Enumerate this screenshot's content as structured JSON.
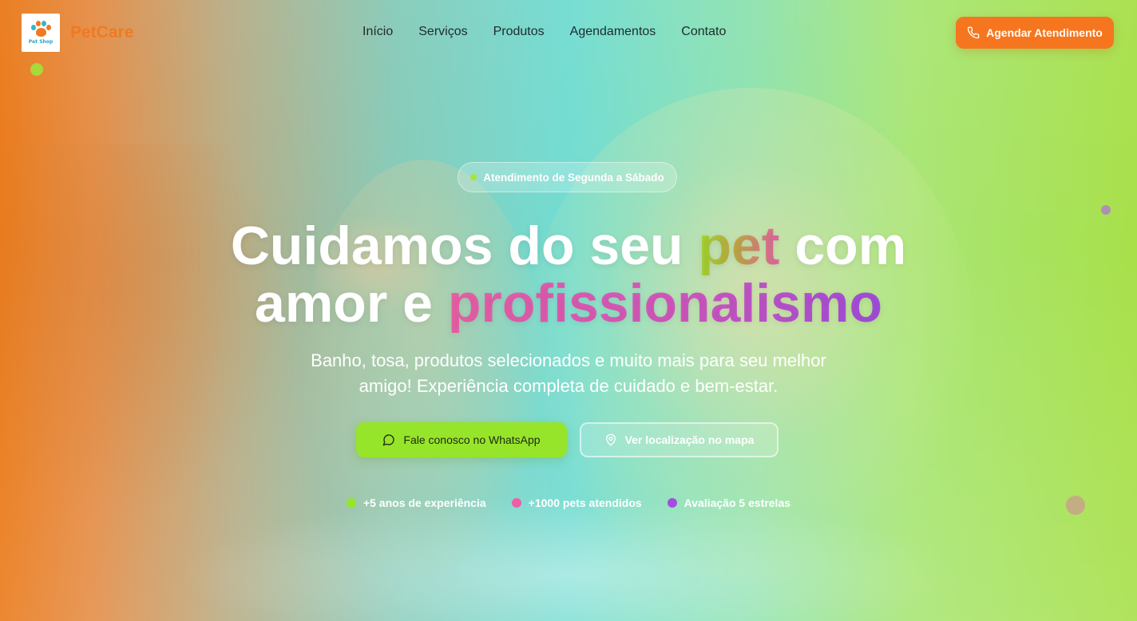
{
  "brand": {
    "name": "PetCare",
    "logo_caption": "Pet Shop",
    "color": "#f07a20"
  },
  "nav": {
    "items": [
      "Início",
      "Serviços",
      "Produtos",
      "Agendamentos",
      "Contato"
    ]
  },
  "header_cta": {
    "label": "Agendar Atendimento",
    "icon": "phone-icon",
    "color": "#f5761e"
  },
  "hero": {
    "badge": "Atendimento de Segunda a Sábado",
    "headline": {
      "part1": "Cuidamos do seu ",
      "highlight1": "pet",
      "part2": " com",
      "part3": "amor e ",
      "highlight2": "profissionalismo"
    },
    "subtitle_line1": "Banho, tosa, produtos selecionados e muito mais para seu melhor",
    "subtitle_line2": "amigo! Experiência completa de cuidado e bem-estar.",
    "primary_button": {
      "label": "Fale conosco no WhatsApp",
      "icon": "chat-bubble-icon",
      "color": "#97e52a"
    },
    "secondary_button": {
      "label": "Ver localização no mapa",
      "icon": "map-pin-icon"
    },
    "stats": [
      {
        "label": "+5 anos de experiência",
        "color": "#97e52a"
      },
      {
        "label": "+1000 pets atendidos",
        "color": "#ec5fa6"
      },
      {
        "label": "Avaliação 5 estrelas",
        "color": "#a24fe0"
      }
    ]
  }
}
